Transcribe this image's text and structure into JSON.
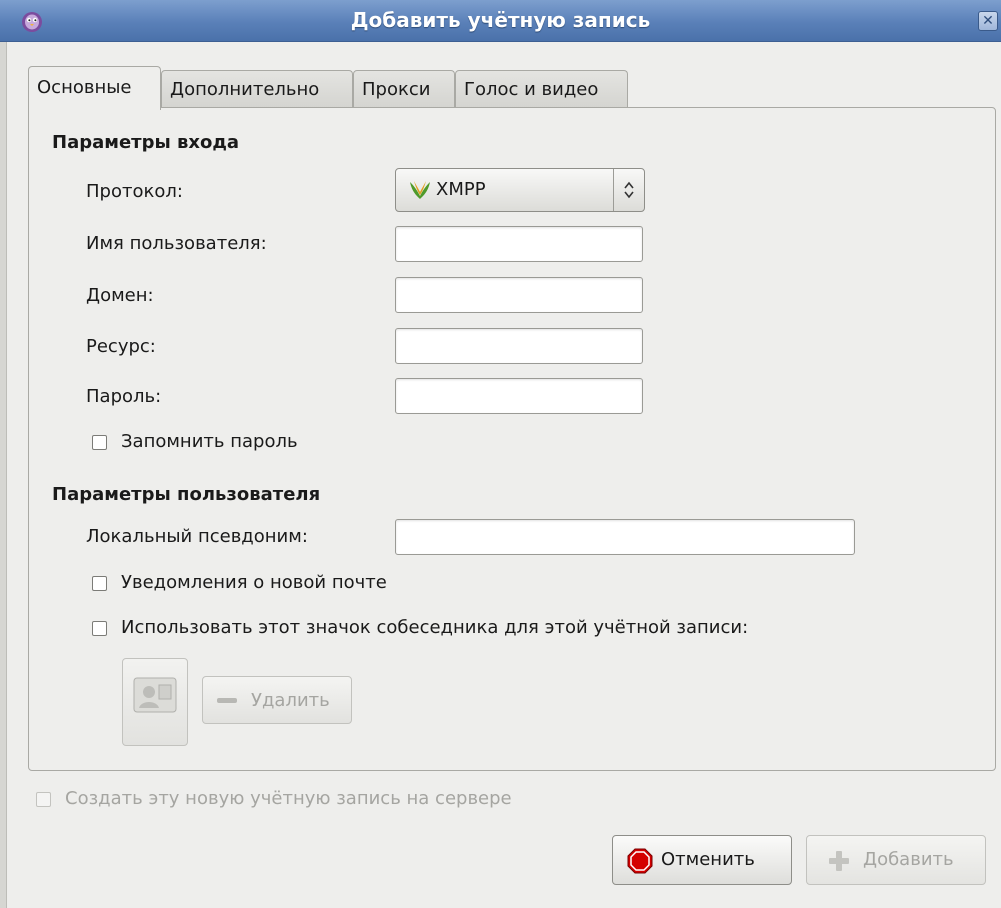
{
  "window": {
    "title": "Добавить учётную запись",
    "close_glyph": "✕"
  },
  "tabs": [
    {
      "label": "Основные",
      "active": true
    },
    {
      "label": "Дополнительно",
      "active": false
    },
    {
      "label": "Прокси",
      "active": false
    },
    {
      "label": "Голос и видео",
      "active": false
    }
  ],
  "login": {
    "section_title": "Параметры входа",
    "protocol_label": "Протокол:",
    "protocol_value": "XMPP",
    "username_label": "Имя пользователя:",
    "username_value": "",
    "domain_label": "Домен:",
    "domain_value": "",
    "resource_label": "Ресурс:",
    "resource_value": "",
    "password_label": "Пароль:",
    "password_value": "",
    "remember_password_label": "Запомнить пароль",
    "remember_password_checked": false
  },
  "user": {
    "section_title": "Параметры пользователя",
    "alias_label": "Локальный псевдоним:",
    "alias_value": "",
    "mail_notify_label": "Уведомления о новой почте",
    "mail_notify_checked": false,
    "buddy_icon_label": "Использовать этот значок собеседника для этой учётной записи:",
    "buddy_icon_checked": false,
    "remove_label": "Удалить"
  },
  "footer": {
    "register_label": "Создать эту новую учётную запись на сервере",
    "register_checked": false,
    "cancel_label": "Отменить",
    "add_label": "Добавить"
  },
  "colors": {
    "titlebar": "#5a80b8",
    "panel_bg": "#eeeeec",
    "cancel_icon": "#d40000",
    "xmpp_icon": "#4f9a2a"
  },
  "icons": {
    "app": "pidgin-icon",
    "protocol": "xmpp-icon",
    "cancel": "stop-icon",
    "add": "plus-icon",
    "avatar": "avatar-placeholder-icon"
  }
}
